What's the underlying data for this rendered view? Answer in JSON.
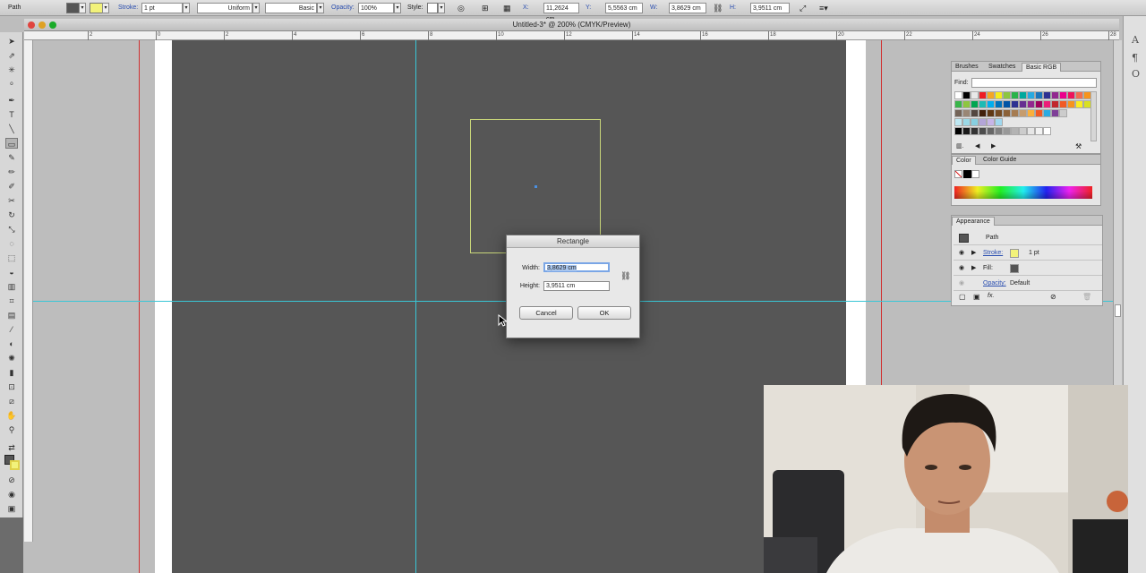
{
  "control_bar": {
    "mode_label": "Path",
    "stroke_label": "Stroke:",
    "stroke_weight": "1 pt",
    "stroke_profile": "Uniform",
    "brush_def": "Basic",
    "opacity_label": "Opacity:",
    "opacity_value": "100%",
    "style_label": "Style:",
    "x_label": "X:",
    "x_value": "11,2624 cm",
    "y_label": "Y:",
    "y_value": "5,5563 cm",
    "w_label": "W:",
    "w_value": "3,8629 cm",
    "h_label": "H:",
    "h_value": "3,9511 cm"
  },
  "window": {
    "title": "Untitled-3* @ 200% (CMYK/Preview)"
  },
  "ruler_ticks": [
    "2",
    "0",
    "2",
    "4",
    "6",
    "8",
    "10",
    "12",
    "14",
    "16",
    "18",
    "20",
    "22",
    "24",
    "26",
    "28"
  ],
  "swatches_panel": {
    "tabs": [
      "Brushes",
      "Swatches",
      "Basic RGB"
    ],
    "find_label": "Find:",
    "find_value": ""
  },
  "color_panel": {
    "tabs": [
      "Color",
      "Color Guide"
    ]
  },
  "appearance_panel": {
    "tab": "Appearance",
    "object_label": "Path",
    "stroke_label": "Stroke:",
    "stroke_value": "1 pt",
    "fill_label": "Fill:",
    "opacity_label": "Opacity:",
    "opacity_value": "Default",
    "fx_label": "fx."
  },
  "rectangle_dialog": {
    "title": "Rectangle",
    "width_label": "Width:",
    "width_value": "3,8629 cm",
    "height_label": "Height:",
    "height_value": "3,9511 cm",
    "cancel_label": "Cancel",
    "ok_label": "OK"
  },
  "colors": {
    "artboard_dark": "#565656",
    "guide": "#39c6d6",
    "bleed": "#d03030",
    "path_stroke": "#c9d67a",
    "stroke_swatch": "#f2f27a"
  }
}
